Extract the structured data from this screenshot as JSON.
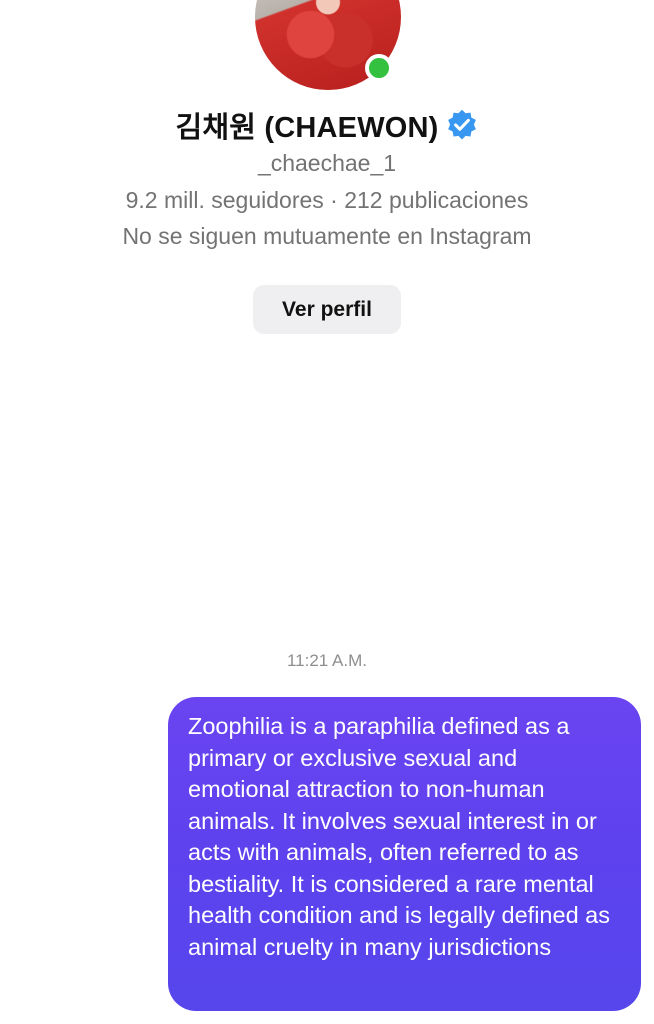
{
  "profile": {
    "name": "김채원 (CHAEWON)",
    "username": "_chaechae_1",
    "stats": "9.2 mill. seguidores · 212 publicaciones",
    "mutual_status": "No se siguen mutuamente en Instagram",
    "view_profile_label": "Ver perfil",
    "online_color": "#33c13f",
    "verified_color": "#3897f0"
  },
  "chat": {
    "timestamp": "11:21 A.M.",
    "messages": [
      {
        "sender": "self",
        "text": "Zoophilia is a paraphilia defined as a primary or exclusive sexual and emotional attraction to non-human animals. It involves sexual interest in or acts with animals, often referred to as bestiality. It is considered a rare mental health condition and is legally defined as animal cruelty in many jurisdictions",
        "bubble_color": "#5d42ee"
      }
    ]
  }
}
